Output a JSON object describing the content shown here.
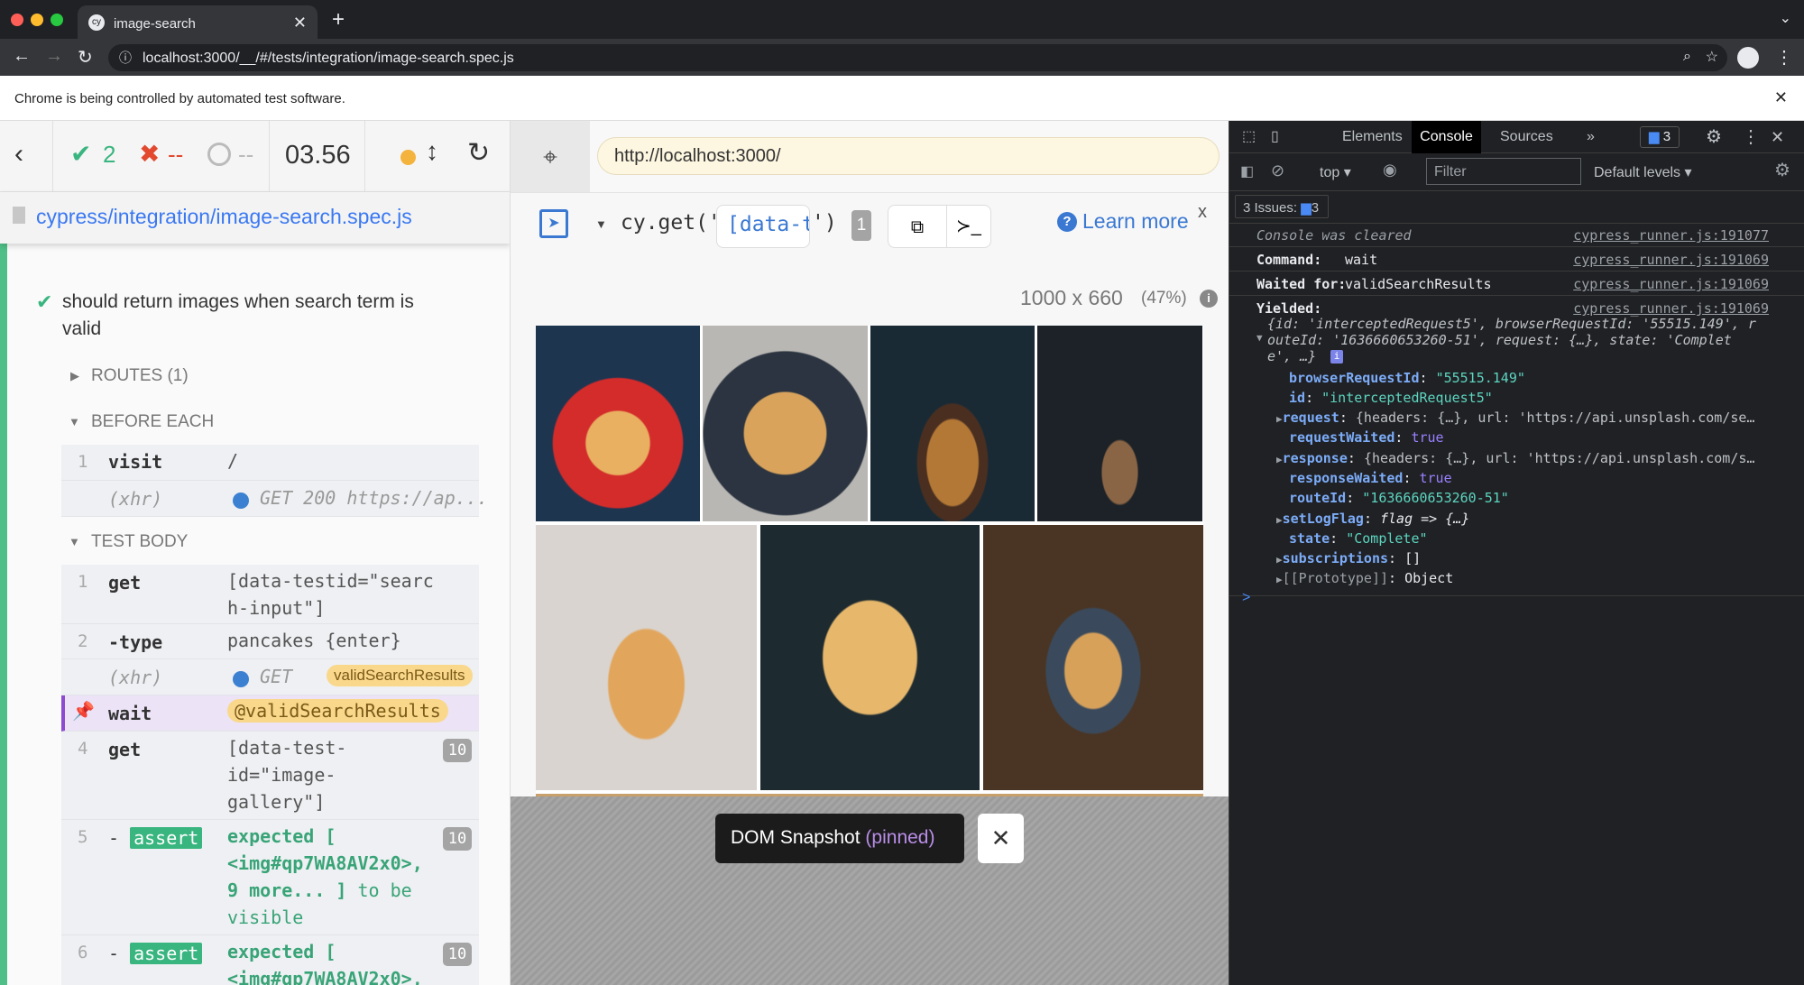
{
  "browser": {
    "tab_title": "image-search",
    "url": "localhost:3000/__/#/tests/integration/image-search.spec.js",
    "infobar": "Chrome is being controlled by automated test software."
  },
  "reporter": {
    "passed": "2",
    "failed": "--",
    "pending": "--",
    "duration": "03.56",
    "spec_path": "cypress/integration/image-search.spec.js",
    "test_title": "should return images when search term is valid",
    "routes_label": "ROUTES (1)",
    "before_each_label": "BEFORE EACH",
    "test_body_label": "TEST BODY",
    "before_each": [
      {
        "num": "1",
        "name": "visit",
        "message": "/"
      },
      {
        "num": "",
        "name": "(xhr)",
        "message": "GET 200 https://ap..."
      }
    ],
    "commands": [
      {
        "num": "1",
        "name": "get",
        "message": "[data-testid=\"search-input\"]"
      },
      {
        "num": "2",
        "name": "-type",
        "message": "pancakes {enter}"
      },
      {
        "num": "",
        "name": "(xhr)",
        "message": "GET ...",
        "alias": "validSearchResults"
      },
      {
        "num": "",
        "name": "wait",
        "message": "@validSearchResults"
      },
      {
        "num": "4",
        "name": "get",
        "message": "[data-test-id=\"image-gallery\"] img",
        "count": "10"
      },
      {
        "num": "5",
        "name": "assert",
        "message_a": "expected [ <img#qp7WA8AV2x0>, 9 more... ]",
        "message_b": " to be visible",
        "count": "10"
      },
      {
        "num": "6",
        "name": "assert",
        "message_a": "expected [ <img#qp7WA8AV2x0>,",
        "count": "10"
      }
    ]
  },
  "aut": {
    "url": "http://localhost:3000/",
    "selector_prefix": "cy.get('",
    "selector_value": "[data-test",
    "selector_suffix": "')",
    "match_count": "1",
    "learn_more": "Learn more",
    "close": "x",
    "viewport": "1000 x 660",
    "scale": "(47%)",
    "snapshot_label": "DOM Snapshot",
    "snapshot_state": "(pinned)"
  },
  "devtools": {
    "tabs": [
      "Elements",
      "Console",
      "Sources"
    ],
    "active_tab": "Console",
    "issues_badge": "3",
    "context": "top",
    "filter_placeholder": "Filter",
    "levels": "Default levels",
    "issues_label": "3 Issues:",
    "issues_count": "3",
    "logs": [
      {
        "text": "Console was cleared",
        "source": "cypress_runner.js:191077"
      },
      {
        "key": "Command:",
        "value": "wait",
        "source": "cypress_runner.js:191069"
      },
      {
        "key": "Waited for:",
        "value": "validSearchResults",
        "source": "cypress_runner.js:191069"
      },
      {
        "key": "Yielded:",
        "source": "cypress_runner.js:191069"
      }
    ],
    "summary1": "{id: 'interceptedRequest5', browserRequestId: '55515.149', r",
    "summary2": "outeId: '1636660653260-51', request: {…}, state: 'Complet",
    "summary3": "e', …}",
    "props": [
      {
        "k": "browserRequestId",
        "v": "\"55515.149\""
      },
      {
        "k": "id",
        "v": "\"interceptedRequest5\""
      },
      {
        "k": "request",
        "v": "{headers: {…}, url: 'https://api.unsplash.com/se…"
      },
      {
        "k": "requestWaited",
        "v": "true"
      },
      {
        "k": "response",
        "v": "{headers: {…}, url: 'https://api.unsplash.com/s…"
      },
      {
        "k": "responseWaited",
        "v": "true"
      },
      {
        "k": "routeId",
        "v": "\"1636660653260-51\""
      },
      {
        "k": "setLogFlag",
        "v": "flag => {…}"
      },
      {
        "k": "state",
        "v": "\"Complete\""
      },
      {
        "k": "subscriptions",
        "v": "[]"
      },
      {
        "k": "[[Prototype]]",
        "v": "Object"
      }
    ],
    "prompt": ">"
  }
}
